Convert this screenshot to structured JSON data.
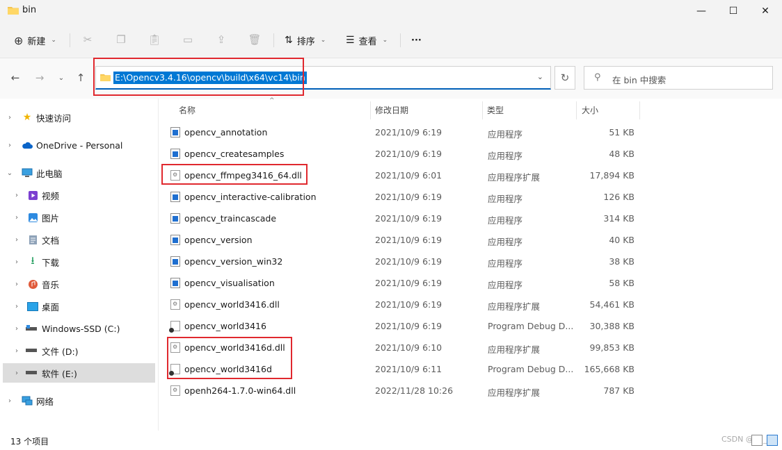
{
  "window": {
    "title": "bin",
    "controls": {
      "minimize": "—",
      "maximize": "☐",
      "close": "✕"
    }
  },
  "toolbar": {
    "new_label": "新建",
    "sort_label": "排序",
    "view_label": "查看",
    "more_label": "···",
    "icons": [
      "cut-icon",
      "copy-icon",
      "paste-icon",
      "rename-icon",
      "share-icon",
      "delete-icon"
    ]
  },
  "address": {
    "path": "E:\\Opencv3.4.16\\opencv\\build\\x64\\vc14\\bin",
    "search_placeholder": "在 bin 中搜索",
    "accent": "#0078d4"
  },
  "sidebar": {
    "items": [
      {
        "label": "快速访问",
        "icon": "star-icon"
      },
      {
        "label": "OneDrive - Personal",
        "icon": "cloud-icon"
      },
      {
        "label": "此电脑",
        "icon": "computer-icon"
      },
      {
        "label": "视频",
        "icon": "video-icon"
      },
      {
        "label": "图片",
        "icon": "pictures-icon"
      },
      {
        "label": "文档",
        "icon": "documents-icon"
      },
      {
        "label": "下载",
        "icon": "download-icon"
      },
      {
        "label": "音乐",
        "icon": "music-icon"
      },
      {
        "label": "桌面",
        "icon": "desktop-icon"
      },
      {
        "label": "Windows-SSD (C:)",
        "icon": "drive-icon"
      },
      {
        "label": "文件 (D:)",
        "icon": "drive-icon"
      },
      {
        "label": "软件 (E:)",
        "icon": "drive-icon"
      },
      {
        "label": "网络",
        "icon": "network-icon"
      }
    ]
  },
  "columns": {
    "name": "名称",
    "date": "修改日期",
    "type": "类型",
    "size": "大小"
  },
  "files": [
    {
      "name": "opencv_annotation",
      "date": "2021/10/9 6:19",
      "type": "应用程序",
      "size": "51 KB",
      "kind": "exe"
    },
    {
      "name": "opencv_createsamples",
      "date": "2021/10/9 6:19",
      "type": "应用程序",
      "size": "48 KB",
      "kind": "exe"
    },
    {
      "name": "opencv_ffmpeg3416_64.dll",
      "date": "2021/10/9 6:01",
      "type": "应用程序扩展",
      "size": "17,894 KB",
      "kind": "dll"
    },
    {
      "name": "opencv_interactive-calibration",
      "date": "2021/10/9 6:19",
      "type": "应用程序",
      "size": "126 KB",
      "kind": "exe"
    },
    {
      "name": "opencv_traincascade",
      "date": "2021/10/9 6:19",
      "type": "应用程序",
      "size": "314 KB",
      "kind": "exe"
    },
    {
      "name": "opencv_version",
      "date": "2021/10/9 6:19",
      "type": "应用程序",
      "size": "40 KB",
      "kind": "exe"
    },
    {
      "name": "opencv_version_win32",
      "date": "2021/10/9 6:19",
      "type": "应用程序",
      "size": "38 KB",
      "kind": "exe"
    },
    {
      "name": "opencv_visualisation",
      "date": "2021/10/9 6:19",
      "type": "应用程序",
      "size": "58 KB",
      "kind": "exe"
    },
    {
      "name": "opencv_world3416.dll",
      "date": "2021/10/9 6:19",
      "type": "应用程序扩展",
      "size": "54,461 KB",
      "kind": "dll"
    },
    {
      "name": "opencv_world3416",
      "date": "2021/10/9 6:19",
      "type": "Program Debug D...",
      "size": "30,388 KB",
      "kind": "pdb"
    },
    {
      "name": "opencv_world3416d.dll",
      "date": "2021/10/9 6:10",
      "type": "应用程序扩展",
      "size": "99,853 KB",
      "kind": "dll"
    },
    {
      "name": "opencv_world3416d",
      "date": "2021/10/9 6:11",
      "type": "Program Debug D...",
      "size": "165,668 KB",
      "kind": "pdb"
    },
    {
      "name": "openh264-1.7.0-win64.dll",
      "date": "2022/11/28 10:26",
      "type": "应用程序扩展",
      "size": "787 KB",
      "kind": "dll"
    }
  ],
  "status": {
    "count": "13 个项目",
    "watermark": "CSDN @qq_..."
  }
}
